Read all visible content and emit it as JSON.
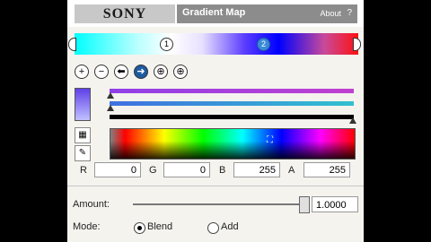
{
  "header": {
    "brand": "SONY",
    "title": "Gradient Map",
    "about": "About",
    "help": "?"
  },
  "gradient": {
    "stops": [
      {
        "label": "",
        "selected": false
      },
      {
        "label": "1",
        "selected": false
      },
      {
        "label": "2",
        "selected": true
      },
      {
        "label": "",
        "selected": false
      }
    ]
  },
  "toolbar": {
    "add": "+",
    "remove": "−",
    "next": "➜",
    "distribute": "⊕",
    "reverse": "⊕"
  },
  "rgba": {
    "r_label": "R",
    "r_value": "0",
    "g_label": "G",
    "g_value": "0",
    "b_label": "B",
    "b_value": "255",
    "a_label": "A",
    "a_value": "255"
  },
  "colors": {
    "slider_top": "#a040e0",
    "slider_mid": "#30a0d0",
    "slider_bottom": "#000000"
  },
  "amount": {
    "label": "Amount:",
    "value": "1.0000"
  },
  "mode": {
    "label": "Mode:",
    "options": [
      "Blend",
      "Add"
    ],
    "selected": "Blend"
  }
}
